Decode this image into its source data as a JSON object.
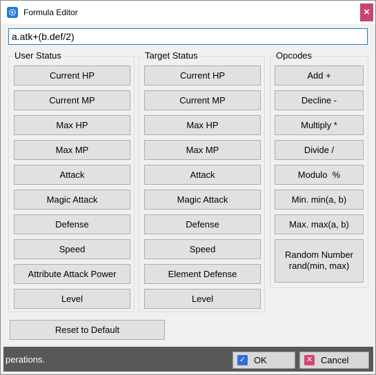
{
  "window": {
    "title": "Formula Editor",
    "close_label": "×"
  },
  "formula": {
    "value": "a.atk+(b.def/2)"
  },
  "user_status": {
    "label": "User Status",
    "buttons": [
      "Current HP",
      "Current MP",
      "Max HP",
      "Max MP",
      "Attack",
      "Magic Attack",
      "Defense",
      "Speed",
      "Attribute Attack Power",
      "Level"
    ]
  },
  "target_status": {
    "label": "Target Status",
    "buttons": [
      "Current HP",
      "Current MP",
      "Max HP",
      "Max MP",
      "Attack",
      "Magic Attack",
      "Defense",
      "Speed",
      "Element Defense",
      "Level"
    ]
  },
  "opcodes": {
    "label": "Opcodes",
    "buttons": [
      "Add +",
      "Decline -",
      "Multiply *",
      "Divide /",
      "Modulo  %",
      "Min. min(a, b)",
      "Max. max(a, b)"
    ],
    "random_line1": "Random Number",
    "random_line2": "rand(min, max)"
  },
  "reset_label": "Reset to Default",
  "status_bar": {
    "text": "perations."
  },
  "dialog": {
    "ok_label": "OK",
    "cancel_label": "Cancel"
  },
  "colors": {
    "accent": "#2c74c8",
    "close": "#c8446e",
    "status_bg": "#585858"
  }
}
